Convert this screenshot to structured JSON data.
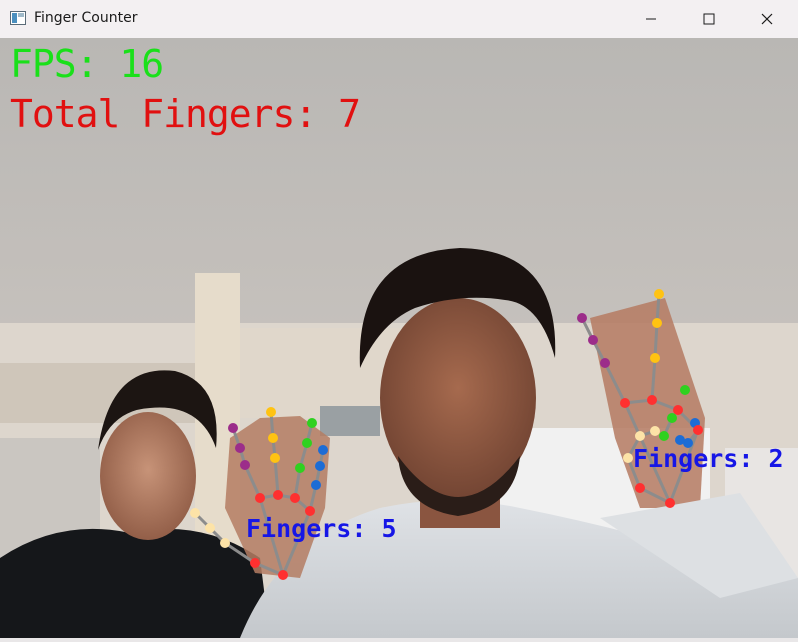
{
  "window": {
    "title": "Finger Counter",
    "icon": "opencv-window-icon"
  },
  "controls": {
    "minimize_icon": "minimize-icon",
    "maximize_icon": "maximize-icon",
    "close_icon": "close-icon"
  },
  "overlay": {
    "fps_text": "FPS: 16",
    "total_text": "Total Fingers: 7",
    "fps_color": "#1ae01a",
    "total_color": "#e11010",
    "hand_label_color": "#1616e6"
  },
  "hands": [
    {
      "label": "Fingers: 5",
      "fingers": 5
    },
    {
      "label": "Fingers: 2",
      "fingers": 2
    }
  ],
  "landmark_colors": {
    "thumb": "#fde3a7",
    "index": "#9c2d8a",
    "middle": "#ffc312",
    "ring": "#2fd11f",
    "pinky": "#1d6cd5",
    "palm": "#ff3030",
    "bones": "#888888"
  }
}
